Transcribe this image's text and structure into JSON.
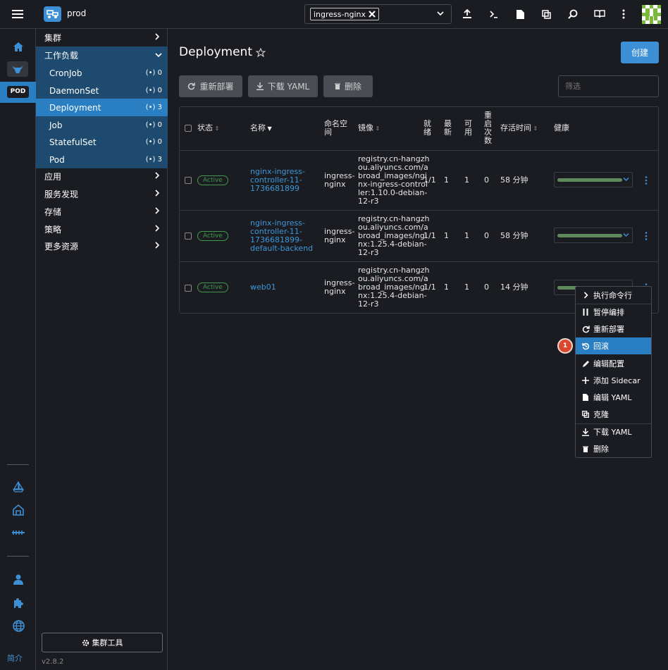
{
  "topbar": {
    "cluster_name": "prod",
    "namespace_chip": "ingress-nginx"
  },
  "rail": {
    "pod_badge": "POD",
    "about_link": "简介",
    "version": "v2.8.2"
  },
  "sidebar": {
    "items": [
      {
        "label": "集群"
      },
      {
        "label": "工作负载"
      },
      {
        "label": "CronJob",
        "count": "0"
      },
      {
        "label": "DaemonSet",
        "count": "0"
      },
      {
        "label": "Deployment",
        "count": "3"
      },
      {
        "label": "Job",
        "count": "0"
      },
      {
        "label": "StatefulSet",
        "count": "0"
      },
      {
        "label": "Pod",
        "count": "3"
      },
      {
        "label": "应用"
      },
      {
        "label": "服务发现"
      },
      {
        "label": "存储"
      },
      {
        "label": "策略"
      },
      {
        "label": "更多资源"
      }
    ],
    "tools_button": "集群工具"
  },
  "main": {
    "title": "Deployment",
    "create_button": "创建",
    "redeploy_button": "重新部署",
    "download_yaml_button": "下载 YAML",
    "delete_button": "删除",
    "filter_placeholder": "筛选"
  },
  "table": {
    "headers": {
      "status": "状态",
      "name": "名称",
      "namespace_l1": "命名空",
      "namespace_l2": "间",
      "image": "镜像",
      "ready_l1": "就",
      "ready_l2": "绪",
      "uptodate_l1": "最",
      "uptodate_l2": "新",
      "available_l1": "可",
      "available_l2": "用",
      "restarts_l1": "重",
      "restarts_l2": "启",
      "restarts_l3": "次",
      "restarts_l4": "数",
      "age": "存活时间",
      "health": "健康"
    },
    "rows": [
      {
        "status": "Active",
        "name": [
          "nginx-ingress-",
          "controller-11-",
          "1736681899"
        ],
        "namespace": [
          "ingress-",
          "nginx"
        ],
        "image": [
          "registry.cn-hangzh",
          "ou.aliyuncs.com/a",
          "broad_images/ngi",
          "nx-ingress-control",
          "ler:1.10.0-debian-",
          "12-r3"
        ],
        "ready": "1/1",
        "uptodate": "1",
        "available": "1",
        "restarts": "0",
        "age": "58 分钟"
      },
      {
        "status": "Active",
        "name": [
          "nginx-ingress-",
          "controller-11-",
          "1736681899-",
          "default-backend"
        ],
        "namespace": [
          "ingress-",
          "nginx"
        ],
        "image": [
          "registry.cn-hangzh",
          "ou.aliyuncs.com/a",
          "broad_images/ngi",
          "nx:1.25.4-debian-",
          "12-r3"
        ],
        "ready": "1/1",
        "uptodate": "1",
        "available": "1",
        "restarts": "0",
        "age": "58 分钟"
      },
      {
        "status": "Active",
        "name": [
          "web01"
        ],
        "namespace": [
          "ingress-",
          "nginx"
        ],
        "image": [
          "registry.cn-hangzh",
          "ou.aliyuncs.com/a",
          "broad_images/ngi",
          "nx:1.25.4-debian-",
          "12-r3"
        ],
        "ready": "1/1",
        "uptodate": "1",
        "available": "1",
        "restarts": "0",
        "age": "14 分钟"
      }
    ]
  },
  "context_menu": {
    "items": [
      {
        "label": "执行命令行",
        "icon": "chevron-right-icon"
      },
      {
        "label": "暂停编排",
        "icon": "pause-icon"
      },
      {
        "label": "重新部署",
        "icon": "refresh-icon"
      },
      {
        "label": "回滚",
        "icon": "history-icon"
      },
      {
        "label": "编辑配置",
        "icon": "pencil-icon"
      },
      {
        "label": "添加 Sidecar",
        "icon": "plus-icon"
      },
      {
        "label": "编辑 YAML",
        "icon": "file-icon"
      },
      {
        "label": "克隆",
        "icon": "copy-icon"
      },
      {
        "label": "下载 YAML",
        "icon": "download-icon"
      },
      {
        "label": "删除",
        "icon": "trash-icon"
      }
    ],
    "step_marker": "1"
  },
  "colors": {
    "accent": "#2a7ec2",
    "link": "#3d97d9",
    "active_badge": "#3f9a4c",
    "sidebar_section": "#1d4a6e",
    "step_marker": "#d9482e"
  }
}
